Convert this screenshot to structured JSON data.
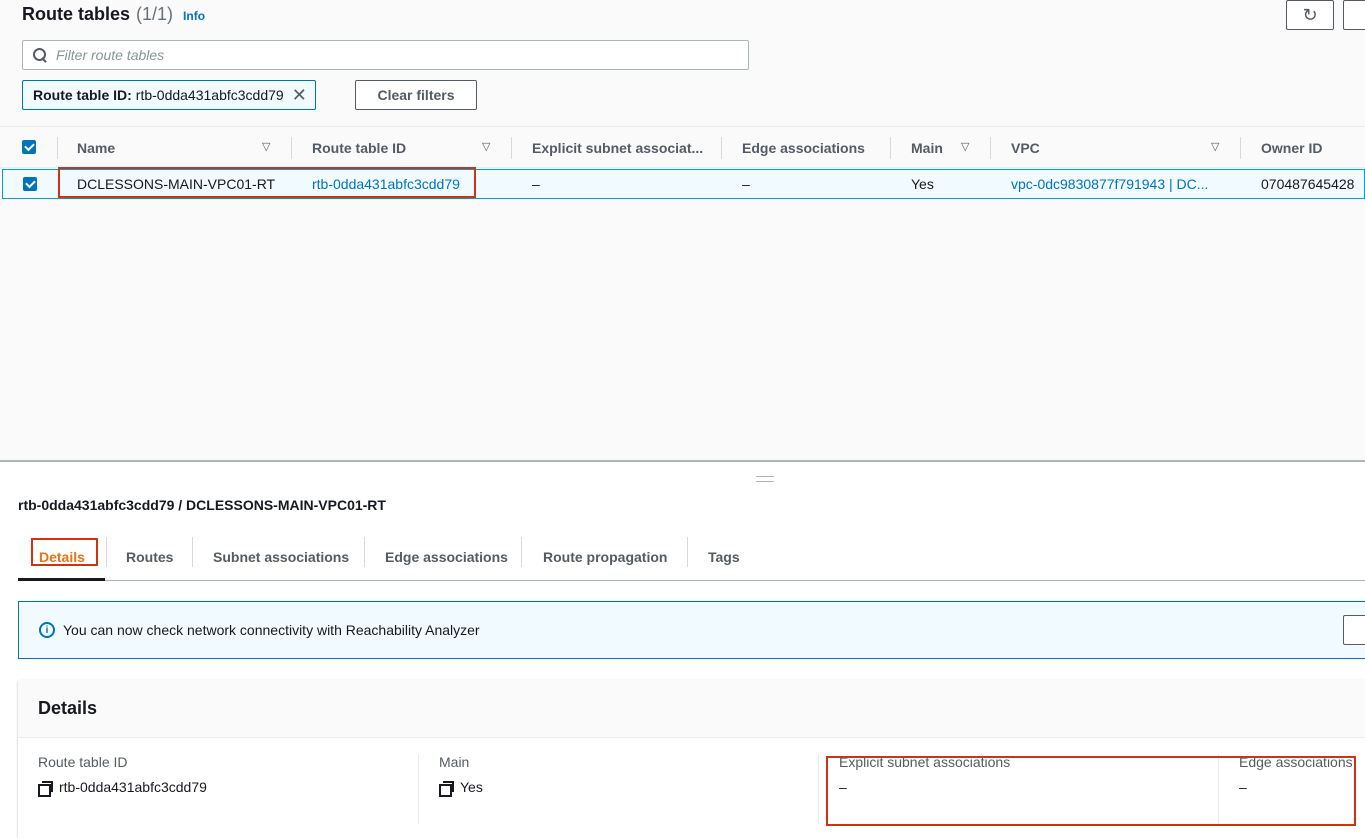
{
  "header": {
    "title": "Route tables",
    "count": "(1/1)",
    "info": "Info",
    "refresh_icon": "refresh-icon"
  },
  "filter": {
    "placeholder": "Filter route tables",
    "token_key": "Route table ID:",
    "token_value": "rtb-0dda431abfc3cdd79",
    "clear_label": "Clear filters"
  },
  "table": {
    "columns": [
      "Name",
      "Route table ID",
      "Explicit subnet associat...",
      "Edge associations",
      "Main",
      "VPC",
      "Owner ID"
    ],
    "rows": [
      {
        "name": "DCLESSONS-MAIN-VPC01-RT",
        "route_table_id": "rtb-0dda431abfc3cdd79",
        "explicit_subnet": "–",
        "edge": "–",
        "main": "Yes",
        "vpc": "vpc-0dc9830877f791943 | DC...",
        "owner": "070487645428"
      }
    ]
  },
  "detail": {
    "title": "rtb-0dda431abfc3cdd79 / DCLESSONS-MAIN-VPC01-RT",
    "tabs": [
      "Details",
      "Routes",
      "Subnet associations",
      "Edge associations",
      "Route propagation",
      "Tags"
    ],
    "active_tab": "Details",
    "alert": "You can now check network connectivity with Reachability Analyzer",
    "card_title": "Details",
    "fields": [
      {
        "label": "Route table ID",
        "value": "rtb-0dda431abfc3cdd79"
      },
      {
        "label": "Main",
        "value": "Yes"
      },
      {
        "label": "Explicit subnet associations",
        "value": "–"
      },
      {
        "label": "Edge associations",
        "value": "–"
      }
    ]
  },
  "colors": {
    "accent": "#0073bb",
    "active_tab": "#ec7211",
    "highlight": "#d13212"
  }
}
